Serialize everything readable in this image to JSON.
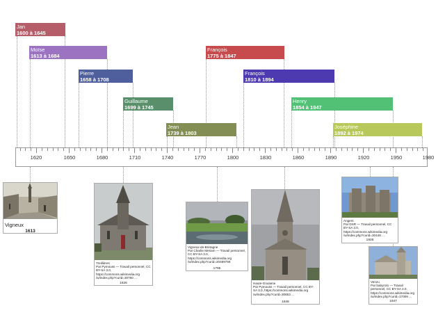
{
  "persons": [
    {
      "name": "Jan",
      "dates": "1600 à 1645",
      "color": "#b55e69"
    },
    {
      "name": "Moïse",
      "dates": "1613 à 1684",
      "color": "#9b73c0"
    },
    {
      "name": "Pierre",
      "dates": "1658 à 1708",
      "color": "#4f5f9e"
    },
    {
      "name": "Guillaume",
      "dates": "1699 à 1745",
      "color": "#5a8f6b"
    },
    {
      "name": "Jean",
      "dates": "1739 à 1803",
      "color": "#838e55"
    },
    {
      "name": "François",
      "dates": "1775 à 1847",
      "color": "#c74a4d"
    },
    {
      "name": "François",
      "dates": "1810 à 1894",
      "color": "#4d39b0"
    },
    {
      "name": "Henry",
      "dates": "1854 à 1947",
      "color": "#52c175"
    },
    {
      "name": "Joséphine",
      "dates": "1892 à 1974",
      "color": "#b9c85a"
    }
  ],
  "axis": {
    "ticks": [
      "1620",
      "1650",
      "1680",
      "1710",
      "1740",
      "1770",
      "1800",
      "1830",
      "1860",
      "1890",
      "1920",
      "1950",
      "1980"
    ]
  },
  "places": [
    {
      "title": "Vigneux",
      "year": "1613",
      "caption": ""
    },
    {
      "title": "Treillières",
      "year": "1626",
      "caption": "Par Pymouss — Travail personnel, CC BY-SA 3.0, https://commons.wikimedia.org /w/index.php?curid=30760 ..."
    },
    {
      "title": "Vigneux-de-Bretagne",
      "year": "1795",
      "caption": "Par Charlie Meriam — Travail personnel, CC BY-SA 3.0, https://commons.wikimedia.org /w/index.php?curid=20489759"
    },
    {
      "title": "Haute-Goulaine",
      "year": "1846",
      "caption": "Par Pymouss — Travail personnel, CC BY-SA 3.0, https://commons.wikimedia.org /w/index.php?curid=30653 ..."
    },
    {
      "title": "Angers",
      "year": "1926",
      "caption": "Par DXR — Travail personnel, CC BY-SA 3.0, https://commons.wikimedia.org /w/index.php?curid=30448 ..."
    },
    {
      "title": "Venzu",
      "year": "1947",
      "caption": "Par babyrolo — Travail personnel, CC BY-SA 3.0, https://commons.wikimedia.org /w/index.php?curid=17009 ..."
    }
  ]
}
